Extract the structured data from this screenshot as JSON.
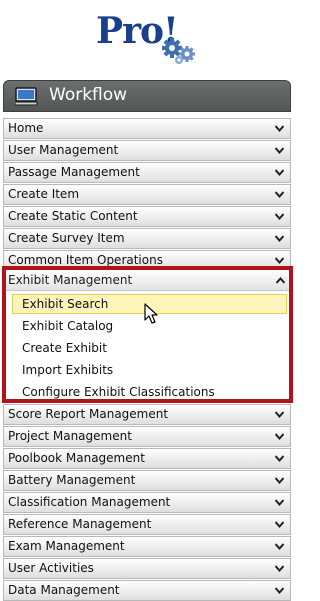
{
  "logo": {
    "text": "Pro!",
    "color": "#1b3f8b"
  },
  "header": {
    "title": "Workflow",
    "icon": "monitor-icon"
  },
  "menu_before": [
    "Home",
    "User Management",
    "Passage Management",
    "Create Item",
    "Create Static Content",
    "Create Survey Item",
    "Common Item Operations"
  ],
  "expanded": {
    "label": "Exhibit Management",
    "highlight_color": "#b1121c",
    "items": [
      {
        "label": "Exhibit Search",
        "active": true
      },
      {
        "label": "Exhibit Catalog"
      },
      {
        "label": "Create Exhibit"
      },
      {
        "label": "Import Exhibits"
      },
      {
        "label": "Configure Exhibit Classifications"
      }
    ]
  },
  "menu_after": [
    "Score Report Management",
    "Project Management",
    "Poolbook Management",
    "Battery Management",
    "Classification Management",
    "Reference Management",
    "Exam Management",
    "User Activities",
    "Data Management"
  ]
}
